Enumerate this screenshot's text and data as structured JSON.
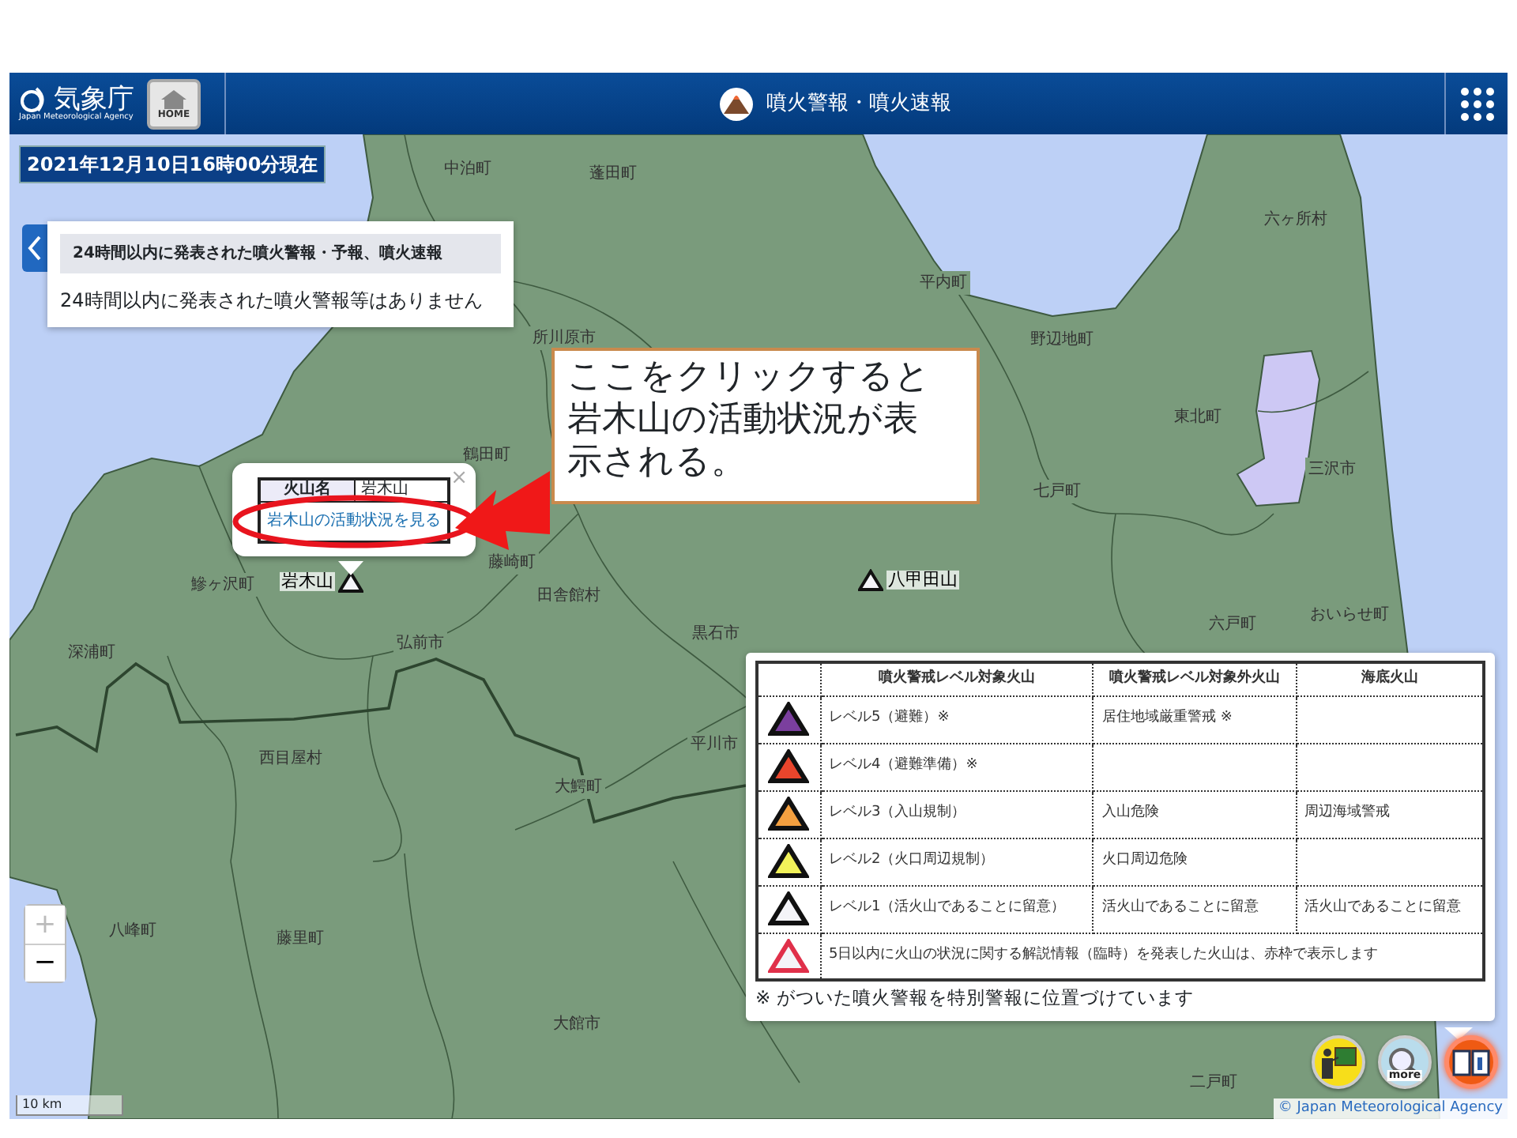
{
  "header": {
    "logo_text": "気象庁",
    "logo_subtext": "Japan Meteorological Agency",
    "home_label": "HOME",
    "title": "噴火警報・噴火速報"
  },
  "timestamp": "2021年12月10日16時00分現在",
  "info_panel": {
    "heading": "24時間以内に発表された噴火警報・予報、噴火速報",
    "message": "24時間以内に発表された噴火警報等はありません"
  },
  "place_labels": [
    {
      "name": "中泊町"
    },
    {
      "name": "蓬田町"
    },
    {
      "name": "六ヶ所村"
    },
    {
      "name": "平内町"
    },
    {
      "name": "所川原市"
    },
    {
      "name": "野辺地町"
    },
    {
      "name": "東北町"
    },
    {
      "name": "三沢市"
    },
    {
      "name": "七戸町"
    },
    {
      "name": "鶴田町"
    },
    {
      "name": "藤崎町"
    },
    {
      "name": "田舎館村"
    },
    {
      "name": "鰺ヶ沢町"
    },
    {
      "name": "深浦町"
    },
    {
      "name": "弘前市"
    },
    {
      "name": "黒石市"
    },
    {
      "name": "六戸町"
    },
    {
      "name": "おいらせ町"
    },
    {
      "name": "平川市"
    },
    {
      "name": "西目屋村"
    },
    {
      "name": "大鰐町"
    },
    {
      "name": "八峰町"
    },
    {
      "name": "藤里町"
    },
    {
      "name": "大館市"
    },
    {
      "name": "二戸町"
    }
  ],
  "volcanoes": [
    {
      "name": "岩木山"
    },
    {
      "name": "八甲田山"
    }
  ],
  "popup": {
    "name_label": "火山名",
    "name_value": "岩木山",
    "link": "岩木山の活動状況を見る",
    "close": "×"
  },
  "callout": {
    "text": "ここをクリックすると岩木山の活動状況が表示される。"
  },
  "legend": {
    "columns": [
      "噴火警戒レベル対象火山",
      "噴火警戒レベル対象外火山",
      "海底火山"
    ],
    "rows": [
      {
        "kind": "level",
        "color": "#7b3f9e",
        "level": "レベル5（避難）※",
        "outside": "居住地域厳重警戒 ※"
      },
      {
        "kind": "level",
        "color": "#e8452c",
        "level": "レベル4（避難準備）※"
      },
      {
        "kind": "level",
        "color": "#f4a040",
        "level": "レベル3（入山規制）",
        "outside": "入山危険",
        "seafloor": "周辺海域警戒"
      },
      {
        "kind": "level",
        "color": "#f2f25a",
        "level": "レベル2（火口周辺規制）",
        "outside": "火口周辺危険"
      },
      {
        "kind": "level",
        "color": "#f4f4f8",
        "level": "レベル1（活火山であることに留意）",
        "outside": "活火山であることに留意",
        "seafloor": "活火山であることに留意"
      },
      {
        "kind": "note",
        "color": "#e0304a",
        "text": "5日以内に火山の状況に関する解説情報（臨時）を発表した火山は、赤枠で表示します"
      }
    ],
    "footnote": "※ がついた噴火警報を特別警報に位置づけています"
  },
  "zoom": {
    "in": "+",
    "in_disabled": true,
    "out": "−"
  },
  "scale": "10 km",
  "attribution": "© Japan Meteorological Agency",
  "tools": [
    {
      "kind": "guide",
      "selected": false
    },
    {
      "kind": "more",
      "label": "more",
      "selected": false
    },
    {
      "kind": "legend",
      "selected": true
    }
  ]
}
